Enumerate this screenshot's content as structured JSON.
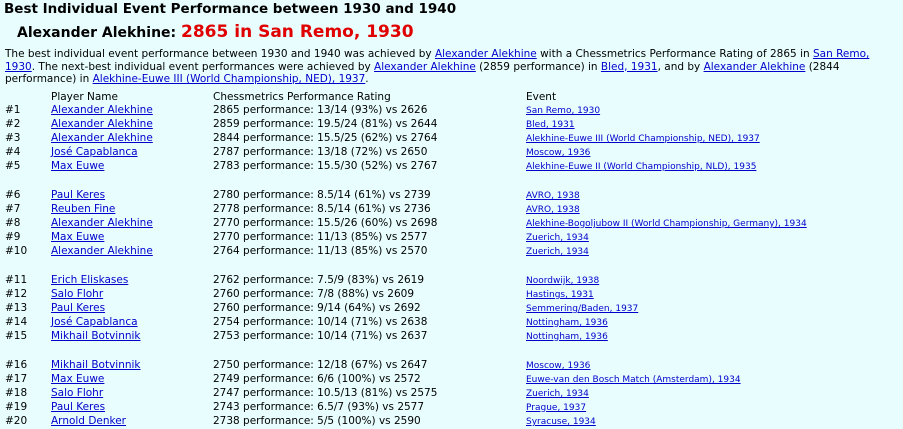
{
  "title": "Best Individual Event Performance between 1930 and 1940",
  "subtitle_name": "Alexander Alekhine:",
  "subtitle_highlight": "2865 in San Remo, 1930",
  "intro": {
    "t1": "The best individual event performance between 1930 and 1940 was achieved by ",
    "l1": "Alexander Alekhine",
    "t2": " with a Chessmetrics Performance Rating of 2865 in ",
    "l2": "San Remo, 1930",
    "t3": ". The next-best individual event performances were achieved by ",
    "l3": "Alexander Alekhine",
    "t4": " (2859 performance) in ",
    "l4": "Bled, 1931",
    "t5": ", and by ",
    "l5": "Alexander Alekhine",
    "t6": " (2844 performance) in ",
    "l6": "Alekhine-Euwe III (World Championship, NED), 1937",
    "t7": "."
  },
  "headers": [
    "Player Name",
    "Chessmetrics Performance Rating",
    "Event"
  ],
  "rows": [
    {
      "rank": "#1",
      "player": "Alexander Alekhine",
      "perf": "2865 performance: 13/14 (93%) vs 2626",
      "event": "San Remo, 1930"
    },
    {
      "rank": "#2",
      "player": "Alexander Alekhine",
      "perf": "2859 performance: 19.5/24 (81%) vs 2644",
      "event": "Bled, 1931"
    },
    {
      "rank": "#3",
      "player": "Alexander Alekhine",
      "perf": "2844 performance: 15.5/25 (62%) vs 2764",
      "event": "Alekhine-Euwe III (World Championship, NED), 1937"
    },
    {
      "rank": "#4",
      "player": "José Capablanca",
      "perf": "2787 performance: 13/18 (72%) vs 2650",
      "event": "Moscow, 1936"
    },
    {
      "rank": "#5",
      "player": "Max Euwe",
      "perf": "2783 performance: 15.5/30 (52%) vs 2767",
      "event": "Alekhine-Euwe II (World Championship, NLD), 1935"
    },
    {
      "rank": "#6",
      "player": "Paul Keres",
      "perf": "2780 performance: 8.5/14 (61%) vs 2739",
      "event": "AVRO, 1938"
    },
    {
      "rank": "#7",
      "player": "Reuben Fine",
      "perf": "2778 performance: 8.5/14 (61%) vs 2736",
      "event": "AVRO, 1938"
    },
    {
      "rank": "#8",
      "player": "Alexander Alekhine",
      "perf": "2770 performance: 15.5/26 (60%) vs 2698",
      "event": "Alekhine-Bogoljubow II (World Championship, Germany), 1934"
    },
    {
      "rank": "#9",
      "player": "Max Euwe",
      "perf": "2770 performance: 11/13 (85%) vs 2577",
      "event": "Zuerich, 1934"
    },
    {
      "rank": "#10",
      "player": "Alexander Alekhine",
      "perf": "2764 performance: 11/13 (85%) vs 2570",
      "event": "Zuerich, 1934"
    },
    {
      "rank": "#11",
      "player": "Erich Eliskases",
      "perf": "2762 performance: 7.5/9 (83%) vs 2619",
      "event": "Noordwijk, 1938"
    },
    {
      "rank": "#12",
      "player": "Salo Flohr",
      "perf": "2760 performance: 7/8 (88%) vs 2609",
      "event": "Hastings, 1931"
    },
    {
      "rank": "#13",
      "player": "Paul Keres",
      "perf": "2760 performance: 9/14 (64%) vs 2692",
      "event": "Semmering/Baden, 1937"
    },
    {
      "rank": "#14",
      "player": "José Capablanca",
      "perf": "2754 performance: 10/14 (71%) vs 2638",
      "event": "Nottingham, 1936"
    },
    {
      "rank": "#15",
      "player": "Mikhail Botvinnik",
      "perf": "2753 performance: 10/14 (71%) vs 2637",
      "event": "Nottingham, 1936"
    },
    {
      "rank": "#16",
      "player": "Mikhail Botvinnik",
      "perf": "2750 performance: 12/18 (67%) vs 2647",
      "event": "Moscow, 1936"
    },
    {
      "rank": "#17",
      "player": "Max Euwe",
      "perf": "2749 performance: 6/6 (100%) vs 2572",
      "event": "Euwe-van den Bosch Match (Amsterdam), 1934"
    },
    {
      "rank": "#18",
      "player": "Salo Flohr",
      "perf": "2747 performance: 10.5/13 (81%) vs 2575",
      "event": "Zuerich, 1934"
    },
    {
      "rank": "#19",
      "player": "Paul Keres",
      "perf": "2743 performance: 6.5/7 (93%) vs 2577",
      "event": "Prague, 1937"
    },
    {
      "rank": "#20",
      "player": "Arnold Denker",
      "perf": "2738 performance: 5/5 (100%) vs 2590",
      "event": "Syracuse, 1934"
    }
  ]
}
